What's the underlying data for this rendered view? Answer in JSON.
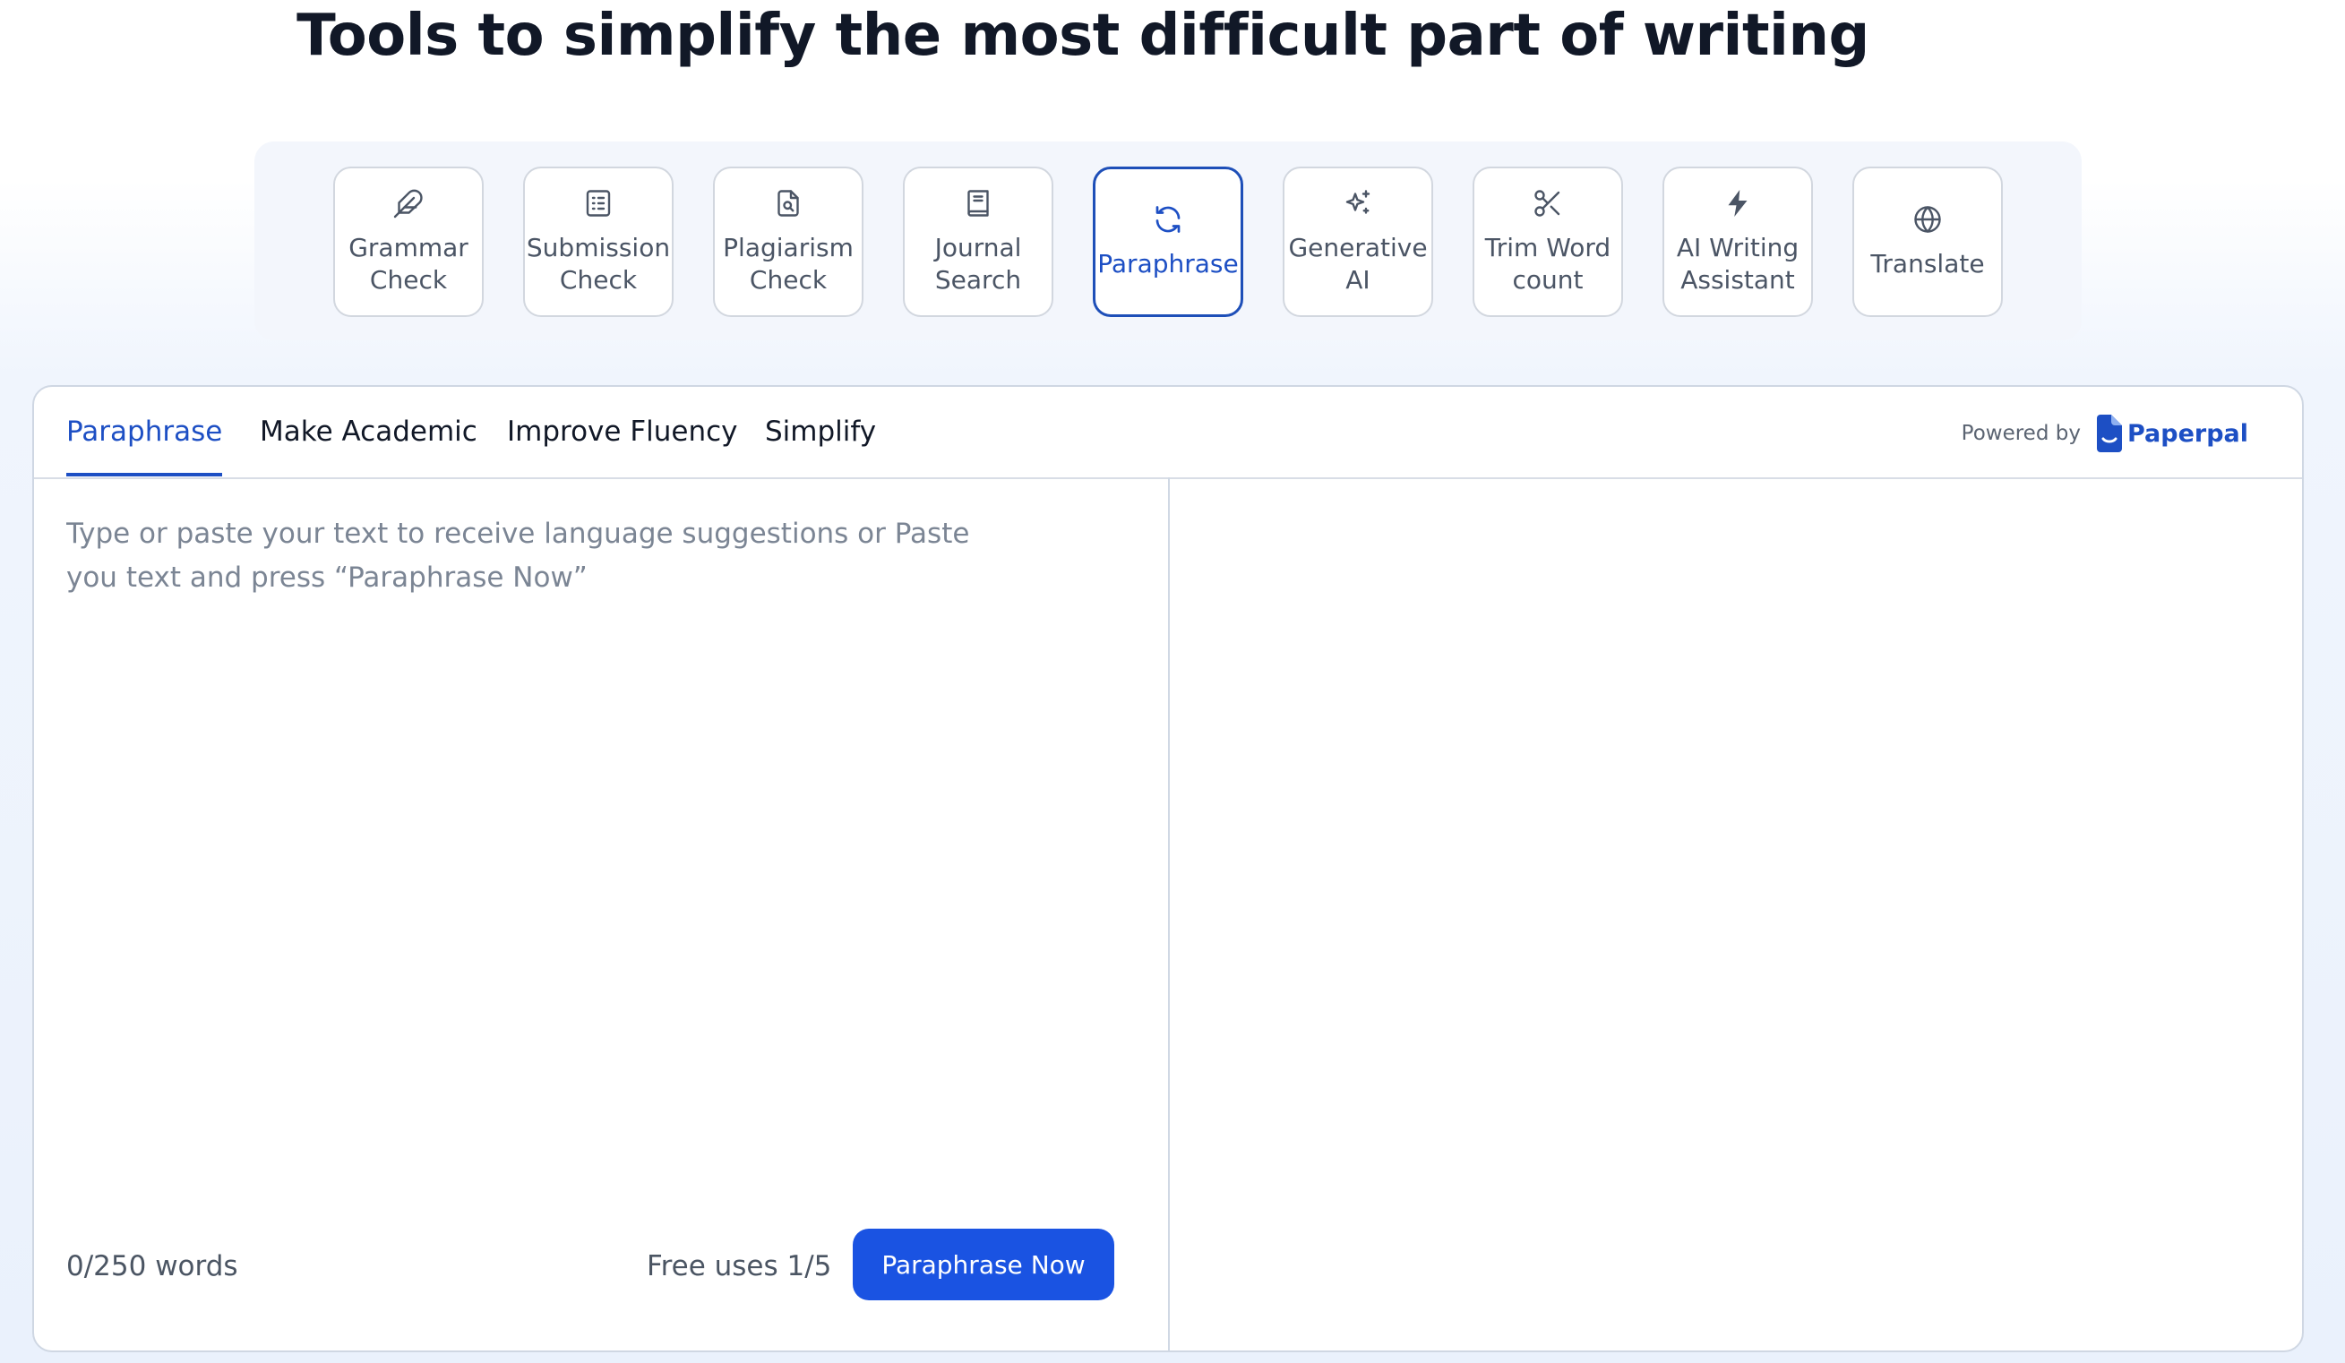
{
  "page": {
    "headline": "Tools to simplify the most difficult part of writing"
  },
  "tools": [
    {
      "label": "Grammar\nCheck",
      "icon": "feather-pen-icon",
      "active": false
    },
    {
      "label": "Submission\nCheck",
      "icon": "checklist-icon",
      "active": false
    },
    {
      "label": "Plagiarism\nCheck",
      "icon": "document-search-icon",
      "active": false
    },
    {
      "label": "Journal\nSearch",
      "icon": "book-icon",
      "active": false
    },
    {
      "label": "Paraphrase",
      "icon": "refresh-icon",
      "active": true
    },
    {
      "label": "Generative\nAI",
      "icon": "sparkles-icon",
      "active": false
    },
    {
      "label": "Trim Word\ncount",
      "icon": "scissors-icon",
      "active": false
    },
    {
      "label": "AI Writing\nAssistant",
      "icon": "lightning-icon",
      "active": false
    },
    {
      "label": "Translate",
      "icon": "globe-icon",
      "active": false
    }
  ],
  "editor_tabs": [
    {
      "label": "Paraphrase",
      "active": true
    },
    {
      "label": "Make Academic",
      "active": false
    },
    {
      "label": "Improve Fluency",
      "active": false
    },
    {
      "label": "Simplify",
      "active": false
    }
  ],
  "powered_by": {
    "label": "Powered by",
    "brand": "Paperpal",
    "brand_icon": "paperpal-logo-icon"
  },
  "editor": {
    "value": "",
    "placeholder": "Type or paste your text to receive language suggestions or Paste\nyou text and press “Paraphrase Now”"
  },
  "footer": {
    "word_count": "0/250 words",
    "free_uses": "Free uses 1/5",
    "button_label": "Paraphrase Now"
  },
  "colors": {
    "accent": "#1d4fc4",
    "cta": "#1a53e2",
    "tile_border": "#d2d7df",
    "tool_text": "#4b5565",
    "placeholder": "#7b8594"
  }
}
